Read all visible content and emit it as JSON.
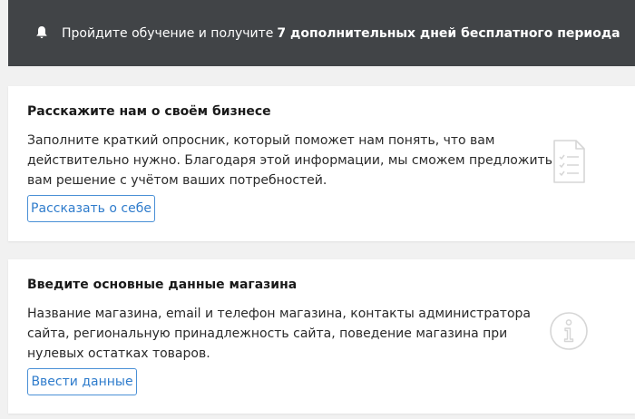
{
  "banner": {
    "icon": "bell-icon",
    "text_prefix": "Пройдите обучение и получите",
    "text_bold": "7 дополнительных дней бесплатного периода"
  },
  "cards": [
    {
      "title": "Расскажите нам о своём бизнесе",
      "description_lines": [
        "Заполните краткий опросник, который поможет нам понять, что вам",
        "действительно нужно. Благодаря этой информации, мы сможем предложить",
        "вам решение с учётом ваших потребностей."
      ],
      "button_label": "Рассказать о себе",
      "icon": "checklist-document-icon"
    },
    {
      "title": "Введите основные данные магазина",
      "description_lines": [
        "Название магазина, email и телефон магазина, контакты администратора",
        "сайта, региональную принадлежность сайта, поведение магазина при",
        "нулевых остатках товаров."
      ],
      "button_label": "Ввести данные",
      "icon": "info-icon"
    }
  ],
  "colors": {
    "banner_bg": "#414447",
    "accent": "#2f7ccc",
    "page_bg": "#f1f1f1",
    "icon_stroke": "#d6d6d6"
  }
}
